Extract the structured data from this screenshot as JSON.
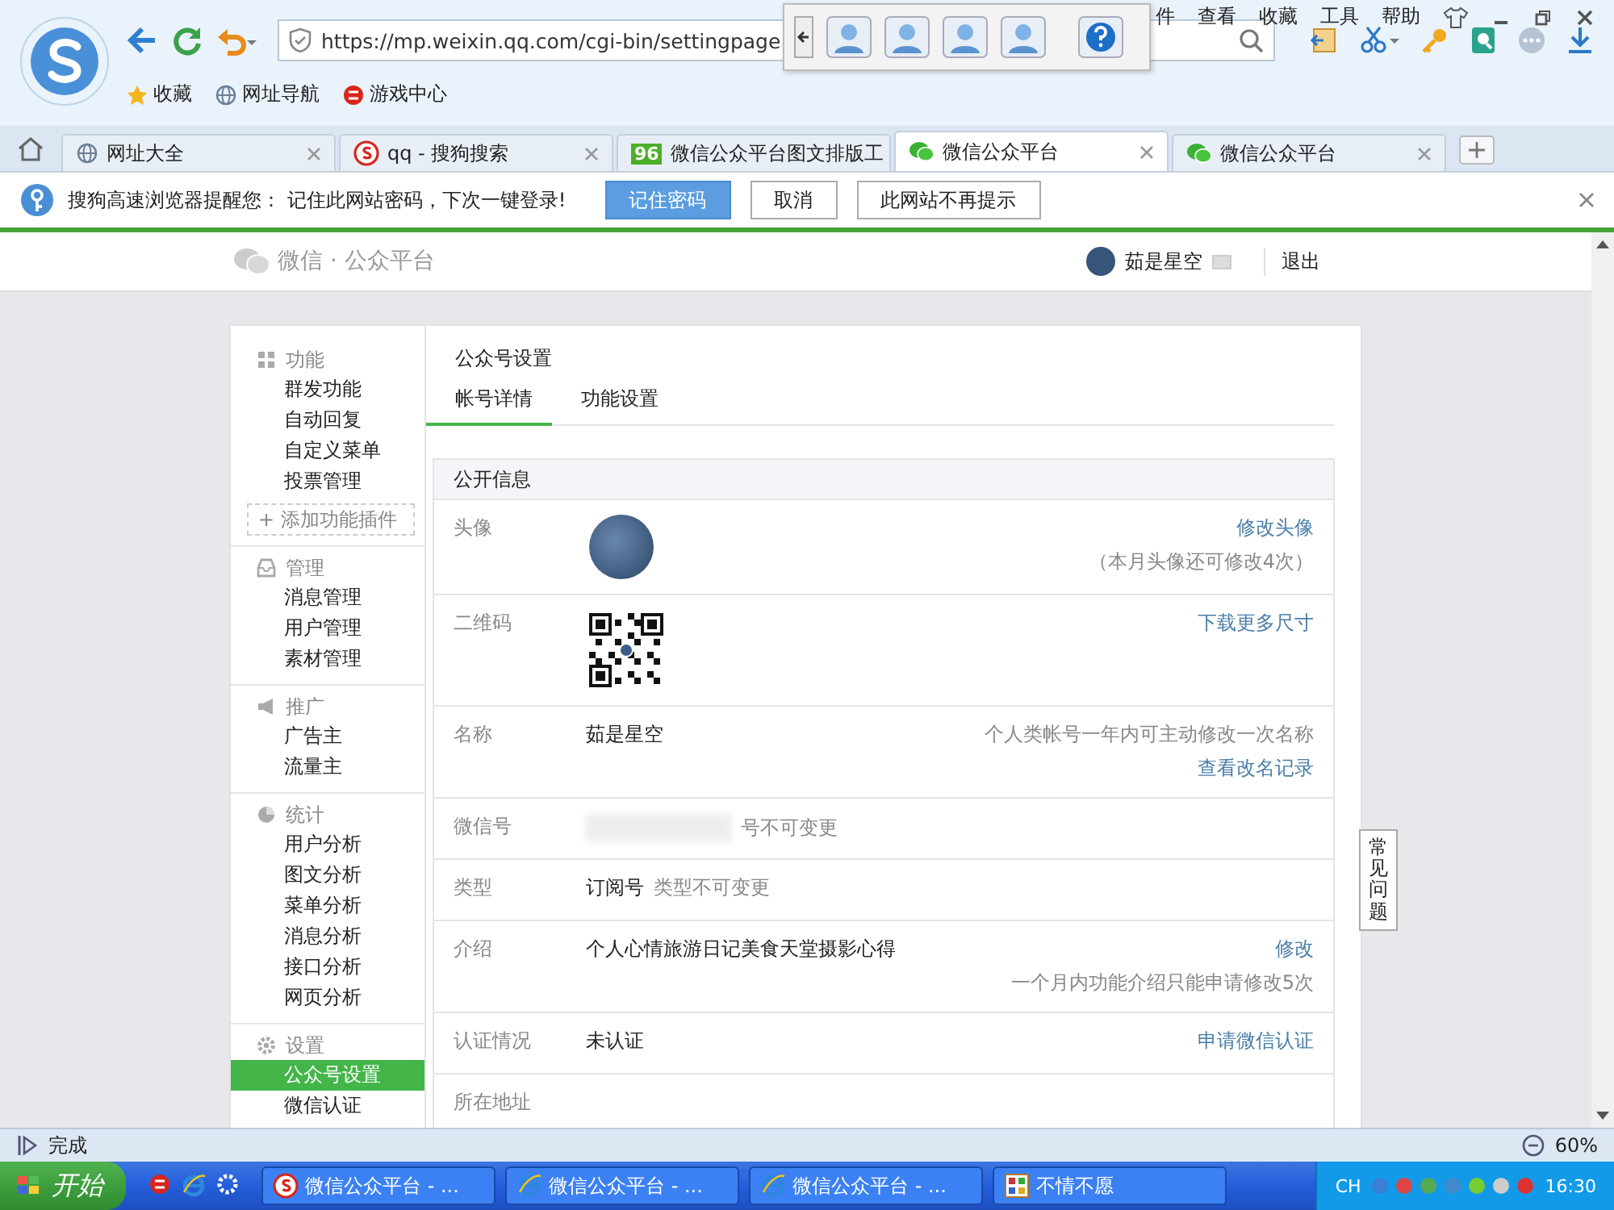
{
  "browser": {
    "menu": [
      "件",
      "查看",
      "收藏",
      "工具",
      "帮助"
    ],
    "url": "https://mp.weixin.qq.com/cgi-bin/settingpage",
    "bookmarks": [
      {
        "label": "收藏",
        "kind": "star"
      },
      {
        "label": "网址导航",
        "kind": "globe"
      },
      {
        "label": "游戏中心",
        "kind": "game"
      }
    ],
    "tabs": [
      {
        "label": "网址大全",
        "kind": "globe",
        "selected": false
      },
      {
        "label": "qq - 搜狗搜索",
        "kind": "sogou",
        "selected": false
      },
      {
        "label": "微信公众平台图文排版工",
        "kind": "num",
        "badge": "96",
        "selected": false
      },
      {
        "label": "微信公众平台",
        "kind": "wechat",
        "selected": true
      },
      {
        "label": "微信公众平台",
        "kind": "wechat",
        "selected": false
      }
    ],
    "notice": {
      "text": "搜狗高速浏览器提醒您： 记住此网站密码，下次一键登录!",
      "buttons": [
        {
          "label": "记住密码",
          "primary": true
        },
        {
          "label": "取消",
          "primary": false
        },
        {
          "label": "此网站不再提示",
          "primary": false
        }
      ]
    }
  },
  "header": {
    "logo": "微信 · 公众平台",
    "user": "茹是星空",
    "logout": "退出"
  },
  "sidebar": {
    "sections": [
      {
        "title": "功能",
        "kind": "grid",
        "items": [
          {
            "label": "群发功能",
            "selected": false
          },
          {
            "label": "自动回复",
            "selected": false
          },
          {
            "label": "自定义菜单",
            "selected": false
          },
          {
            "label": "投票管理",
            "selected": false
          }
        ],
        "add": "+ 添加功能插件"
      },
      {
        "title": "管理",
        "kind": "inbox",
        "items": [
          {
            "label": "消息管理",
            "selected": false
          },
          {
            "label": "用户管理",
            "selected": false
          },
          {
            "label": "素材管理",
            "selected": false
          }
        ]
      },
      {
        "title": "推广",
        "kind": "megaphone",
        "items": [
          {
            "label": "广告主",
            "selected": false
          },
          {
            "label": "流量主",
            "selected": false
          }
        ]
      },
      {
        "title": "统计",
        "kind": "pie",
        "items": [
          {
            "label": "用户分析",
            "selected": false
          },
          {
            "label": "图文分析",
            "selected": false
          },
          {
            "label": "菜单分析",
            "selected": false
          },
          {
            "label": "消息分析",
            "selected": false
          },
          {
            "label": "接口分析",
            "selected": false
          },
          {
            "label": "网页分析",
            "selected": false
          }
        ]
      },
      {
        "title": "设置",
        "kind": "gear",
        "items": [
          {
            "label": "公众号设置",
            "selected": true
          },
          {
            "label": "微信认证",
            "selected": false
          }
        ]
      }
    ]
  },
  "main": {
    "title": "公众号设置",
    "tabs": [
      {
        "label": "帐号详情",
        "selected": true
      },
      {
        "label": "功能设置",
        "selected": false
      }
    ],
    "panel": {
      "title": "公开信息",
      "rows": [
        {
          "label": "头像",
          "kind": "avatar",
          "right": [
            {
              "kind": "link",
              "text": "修改头像"
            },
            {
              "kind": "note",
              "text": "（本月头像还可修改4次）"
            }
          ]
        },
        {
          "label": "二维码",
          "kind": "qr",
          "right": [
            {
              "kind": "link",
              "text": "下载更多尺寸"
            }
          ]
        },
        {
          "label": "名称",
          "kind": "text",
          "value": "茹是星空",
          "right": [
            {
              "kind": "note",
              "text": "个人类帐号一年内可主动修改一次名称"
            },
            {
              "kind": "link",
              "text": "查看改名记录"
            }
          ]
        },
        {
          "label": "微信号",
          "kind": "redacted",
          "hint": "号不可变更"
        },
        {
          "label": "类型",
          "kind": "text",
          "value": "订阅号",
          "hint": "类型不可变更"
        },
        {
          "label": "介绍",
          "kind": "text",
          "value": "个人心情旅游日记美食天堂摄影心得",
          "right": [
            {
              "kind": "link",
              "text": "修改"
            },
            {
              "kind": "note",
              "text": "一个月内功能介绍只能申请修改5次"
            }
          ]
        },
        {
          "label": "认证情况",
          "kind": "text",
          "value": "未认证",
          "right": [
            {
              "kind": "link",
              "text": "申请微信认证"
            }
          ]
        },
        {
          "label": "所在地址",
          "kind": "text"
        }
      ]
    }
  },
  "faq": "常见问题",
  "status": {
    "text": "完成",
    "zoom": "60%"
  },
  "taskbar": {
    "start": "开始",
    "items": [
      {
        "label": "微信公众平台 - ...",
        "kind": "sogou"
      },
      {
        "label": "微信公众平台 - ...",
        "kind": "ie"
      },
      {
        "label": "微信公众平台 - ...",
        "kind": "ie"
      },
      {
        "label": "不情不愿",
        "kind": "app"
      }
    ],
    "lang": "CH",
    "time": "16:30"
  }
}
